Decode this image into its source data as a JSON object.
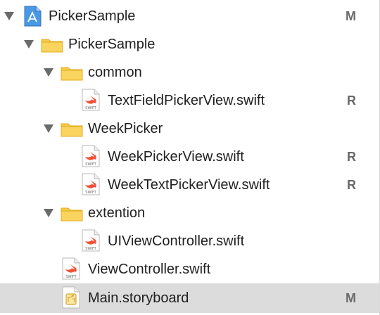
{
  "navigator": {
    "rows": [
      {
        "label": "PickerSample",
        "badge": "M",
        "icon": "xcode-project-icon",
        "expanded": true
      },
      {
        "label": "PickerSample",
        "badge": "",
        "icon": "folder-icon",
        "expanded": true
      },
      {
        "label": "common",
        "badge": "",
        "icon": "folder-icon",
        "expanded": true
      },
      {
        "label": "TextFieldPickerView.swift",
        "badge": "R",
        "icon": "swift-file-icon"
      },
      {
        "label": "WeekPicker",
        "badge": "",
        "icon": "folder-icon",
        "expanded": true
      },
      {
        "label": "WeekPickerView.swift",
        "badge": "R",
        "icon": "swift-file-icon"
      },
      {
        "label": "WeekTextPickerView.swift",
        "badge": "R",
        "icon": "swift-file-icon"
      },
      {
        "label": "extention",
        "badge": "",
        "icon": "folder-icon",
        "expanded": true
      },
      {
        "label": "UIViewController.swift",
        "badge": "",
        "icon": "swift-file-icon"
      },
      {
        "label": "ViewController.swift",
        "badge": "",
        "icon": "swift-file-icon"
      },
      {
        "label": "Main.storyboard",
        "badge": "M",
        "icon": "storyboard-file-icon",
        "selected": true
      }
    ],
    "swift_icon_text": "SWIFT"
  },
  "colors": {
    "folder": "#f7cf57",
    "swift": "#f05138",
    "project_blue": "#3d8fe0",
    "selection": "#dcdcdc"
  }
}
